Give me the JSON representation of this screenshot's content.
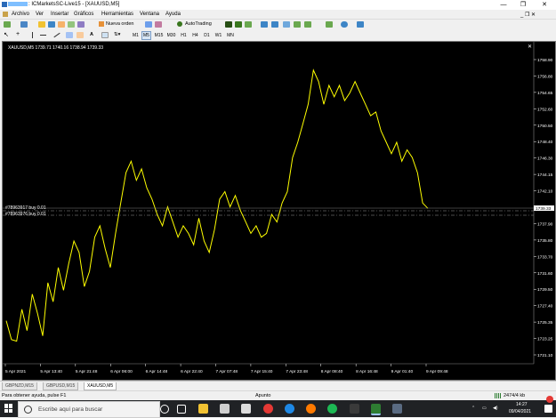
{
  "window": {
    "title": ": ICMarketsSC-Live15 - [XAUUSD,M5]",
    "minimize": "—",
    "maximize": "❐",
    "close": "✕"
  },
  "menu": [
    "Archivo",
    "Ver",
    "Insertar",
    "Gráficos",
    "Herramientas",
    "Ventana",
    "Ayuda"
  ],
  "toolbar": {
    "new_order": "Nueva orden",
    "autotrading": "AutoTrading",
    "timeframes": [
      "M1",
      "M5",
      "M15",
      "M30",
      "H1",
      "H4",
      "D1",
      "W1",
      "MN"
    ],
    "active_timeframe": "M5"
  },
  "chart": {
    "info": "XAUUSD,M5  1739.71 1740.16 1738.94 1739.33",
    "orders": [
      "#78963917 buy 0.01",
      "#78963976 buy 0.01"
    ],
    "current_price": "1739.33",
    "bg_color": "#000000",
    "line_color": "#ffff00",
    "icons": [
      "close-icon"
    ]
  },
  "chart_data": {
    "type": "line",
    "title": "XAUUSD,M5",
    "y_ticks": [
      "1758.90",
      "1756.80",
      "1754.65",
      "1752.60",
      "1750.50",
      "1748.40",
      "1746.30",
      "1744.15",
      "1742.10",
      "1740.00",
      "1737.90",
      "1735.80",
      "1733.70",
      "1731.60",
      "1729.50",
      "1727.40",
      "1725.35",
      "1723.25",
      "1721.10"
    ],
    "x_ticks": [
      "5 Apr 2021",
      "5 Apr 13:40",
      "5 Apr 21:48",
      "6 Apr 06:00",
      "6 Apr 14:48",
      "6 Apr 22:40",
      "7 Apr 07:48",
      "7 Apr 15:40",
      "7 Apr 23:48",
      "8 Apr 08:40",
      "8 Apr 16:48",
      "9 Apr 01:40",
      "9 Apr 09:48"
    ],
    "ylim": [
      1720.0,
      1759.6
    ],
    "values": [
      1724.5,
      1722.0,
      1721.8,
      1726.0,
      1723.2,
      1728.0,
      1725.5,
      1722.5,
      1729.5,
      1727.0,
      1731.5,
      1728.5,
      1732.0,
      1735.0,
      1733.5,
      1729.0,
      1731.0,
      1735.5,
      1737.0,
      1734.0,
      1731.5,
      1736.0,
      1740.0,
      1744.0,
      1745.5,
      1743.0,
      1744.5,
      1742.0,
      1740.5,
      1738.5,
      1737.0,
      1739.5,
      1737.5,
      1735.5,
      1737.0,
      1736.0,
      1734.5,
      1738.0,
      1735.0,
      1733.5,
      1736.5,
      1740.5,
      1741.5,
      1739.5,
      1741.0,
      1739.0,
      1737.5,
      1736.0,
      1737.0,
      1735.5,
      1736.0,
      1738.5,
      1737.5,
      1740.0,
      1741.5,
      1746.0,
      1748.0,
      1750.5,
      1753.0,
      1757.5,
      1756.0,
      1753.0,
      1755.5,
      1754.0,
      1755.5,
      1753.5,
      1754.5,
      1756.0,
      1754.5,
      1753.0,
      1751.5,
      1752.0,
      1749.5,
      1748.0,
      1746.5,
      1748.0,
      1745.5,
      1747.0,
      1746.0,
      1744.0,
      1740.0,
      1739.3
    ]
  },
  "tabs": [
    "GBPNZD,M15",
    "GBPUSD,M15",
    "XAUUSD,M5"
  ],
  "active_tab": "XAUUSD,M5",
  "status": {
    "help": "Para obtener ayuda, pulse F1",
    "profile": "Apunto",
    "traffic": "2474/4 kb"
  },
  "taskbar": {
    "search_placeholder": "Escribe aquí para buscar",
    "time": "14:27",
    "date": "09/04/2021"
  }
}
